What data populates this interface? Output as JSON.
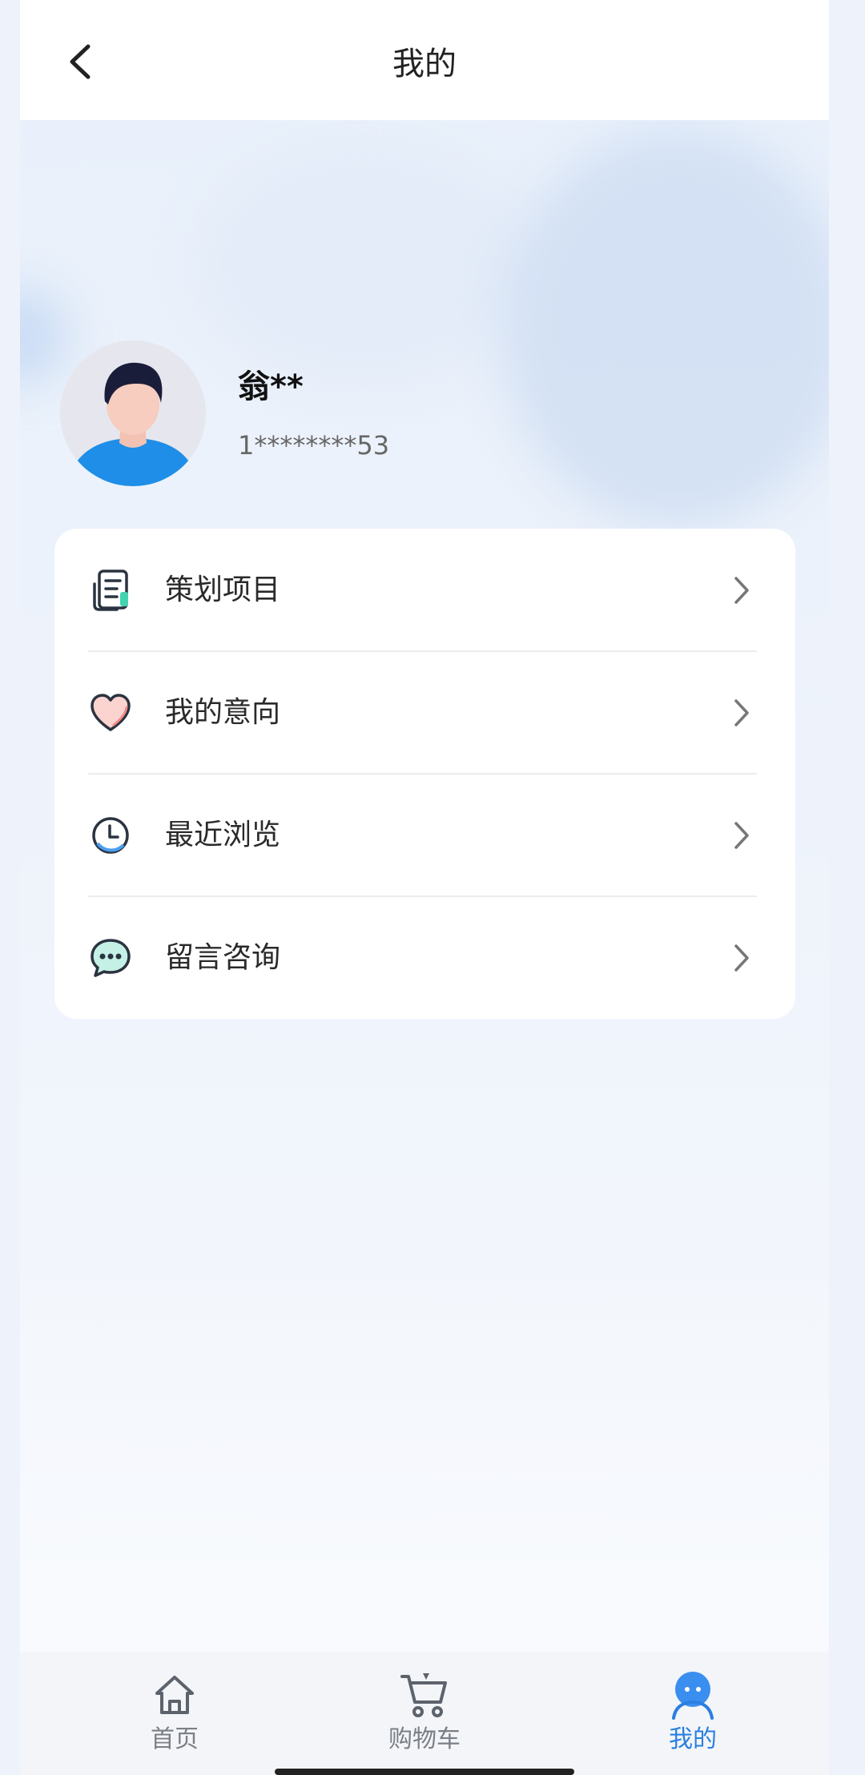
{
  "header": {
    "title": "我的",
    "back_icon": "chevron-left-icon"
  },
  "profile": {
    "name": "翁**",
    "phone": "1********53",
    "avatar_icon": "user-avatar-icon"
  },
  "menu": {
    "items": [
      {
        "label": "策划项目",
        "icon": "document-icon"
      },
      {
        "label": "我的意向",
        "icon": "heart-icon"
      },
      {
        "label": "最近浏览",
        "icon": "clock-icon"
      },
      {
        "label": "留言咨询",
        "icon": "chat-bubble-icon"
      }
    ],
    "chevron_icon": "chevron-right-icon"
  },
  "tabbar": {
    "tabs": [
      {
        "label": "首页",
        "icon": "home-icon",
        "active": false
      },
      {
        "label": "购物车",
        "icon": "cart-icon",
        "active": false
      },
      {
        "label": "我的",
        "icon": "profile-icon",
        "active": true
      }
    ]
  },
  "colors": {
    "accent": "#2a7fe0",
    "background": "#eef3fb",
    "card": "#ffffff"
  }
}
